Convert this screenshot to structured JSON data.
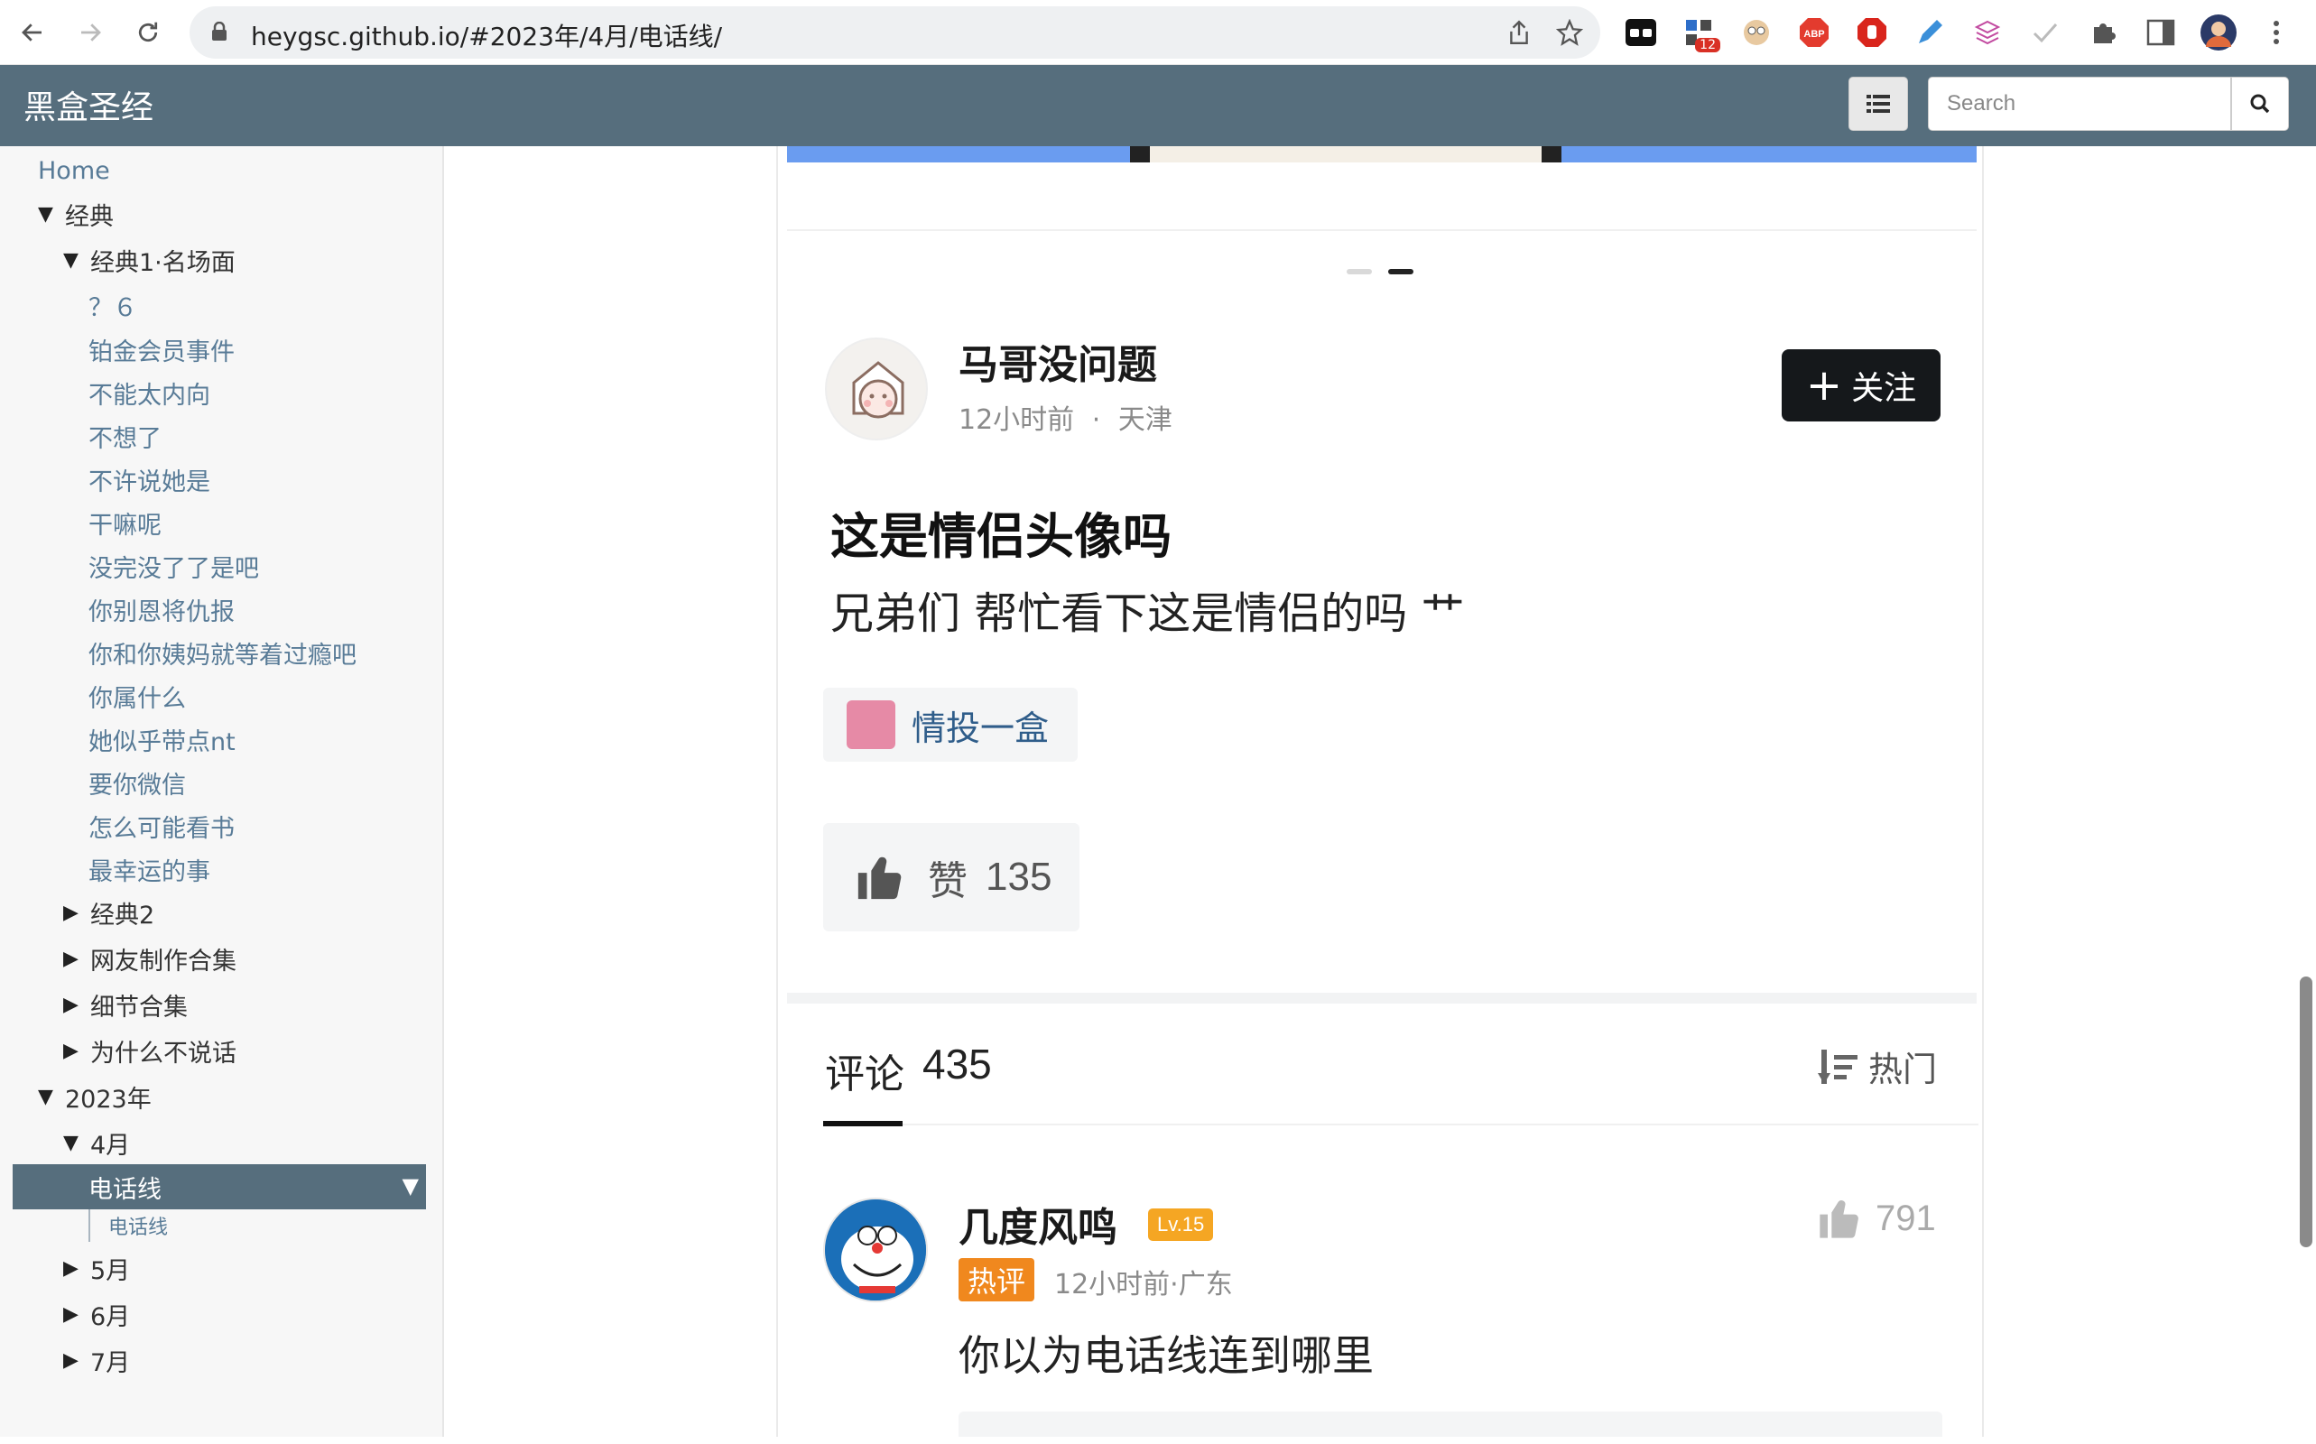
{
  "browser": {
    "url": "heygsc.github.io/#2023年/4月/电话线/",
    "extensions_badge": "12"
  },
  "site": {
    "title": "黑盒圣经",
    "search_placeholder": "Search"
  },
  "sidebar": {
    "home": "Home",
    "classic": "经典",
    "classic1": "经典1·名场面",
    "classic1_items": [
      "？６",
      "铂金会员事件",
      "不能太内向",
      "不想了",
      "不许说她是",
      "干嘛呢",
      "没完没了了是吧",
      "你别恩将仇报",
      "你和你姨妈就等着过瘾吧",
      "你属什么",
      "她似乎带点nt",
      "要你微信",
      "怎么可能看书",
      "最幸运的事"
    ],
    "classic2": "经典2",
    "netizen": "网友制作合集",
    "details": "细节合集",
    "why_silent": "为什么不说话",
    "year2023": "2023年",
    "april": "4月",
    "active_item": "电话线",
    "active_sub": "电话线",
    "may": "5月",
    "june": "6月",
    "july": "7月"
  },
  "post": {
    "author": "马哥没问题",
    "time": "12小时前",
    "location": "天津",
    "meta_separator": "·",
    "follow_label": "关注",
    "title": "这是情侣头像吗",
    "body": "兄弟们 帮忙看下这是情侣的吗 艹",
    "topic": "情投一盒",
    "like_label": "赞",
    "like_count": "135"
  },
  "comments": {
    "label": "评论",
    "count": "435",
    "sort": "热门",
    "items": [
      {
        "name": "几度风鸣",
        "level": "Lv.15",
        "hot_badge": "热评",
        "meta": "12小时前·广东",
        "likes": "791",
        "text": "你以为电话线连到哪里"
      }
    ]
  },
  "colors": {
    "header_bg": "#566e7d",
    "link": "#587b97",
    "follow_bg": "#15181b",
    "level_badge": "#f5a623",
    "hot_badge": "#f0881e"
  }
}
